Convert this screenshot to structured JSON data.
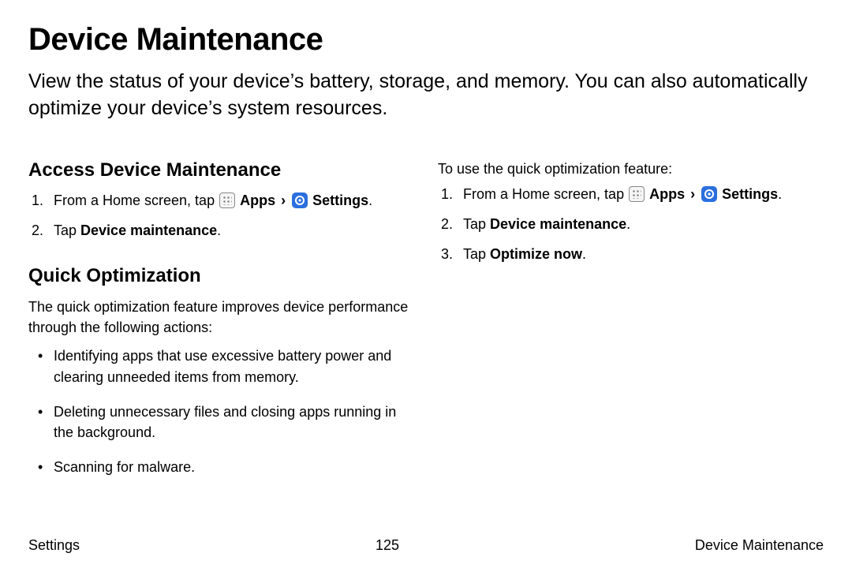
{
  "title": "Device Maintenance",
  "intro": "View the status of your device’s battery, storage, and memory. You can also automatically optimize your device’s system resources.",
  "left": {
    "h_access": "Access Device Maintenance",
    "step1_pre": "From a Home screen, tap ",
    "apps": "Apps",
    "settings": "Settings",
    "step2_pre": "Tap ",
    "device_maint": "Device maintenance",
    "h_quick": "Quick Optimization",
    "quick_intro": "The quick optimization feature improves device performance through the following actions:",
    "bullets": {
      "b1": "Identifying apps that use excessive battery power and clearing unneeded items from memory.",
      "b2": "Deleting unnecessary files and closing apps running in the background.",
      "b3": "Scanning for malware."
    }
  },
  "right": {
    "lead": "To use the quick optimization feature:",
    "step1_pre": "From a Home screen, tap ",
    "apps": "Apps",
    "settings": "Settings",
    "step2_pre": "Tap ",
    "device_maint": "Device maintenance",
    "step3_pre": "Tap ",
    "optimize": "Optimize now"
  },
  "footer": {
    "left": "Settings",
    "center": "125",
    "right": "Device Maintenance"
  },
  "glyphs": {
    "chevron": "›",
    "period": "."
  }
}
